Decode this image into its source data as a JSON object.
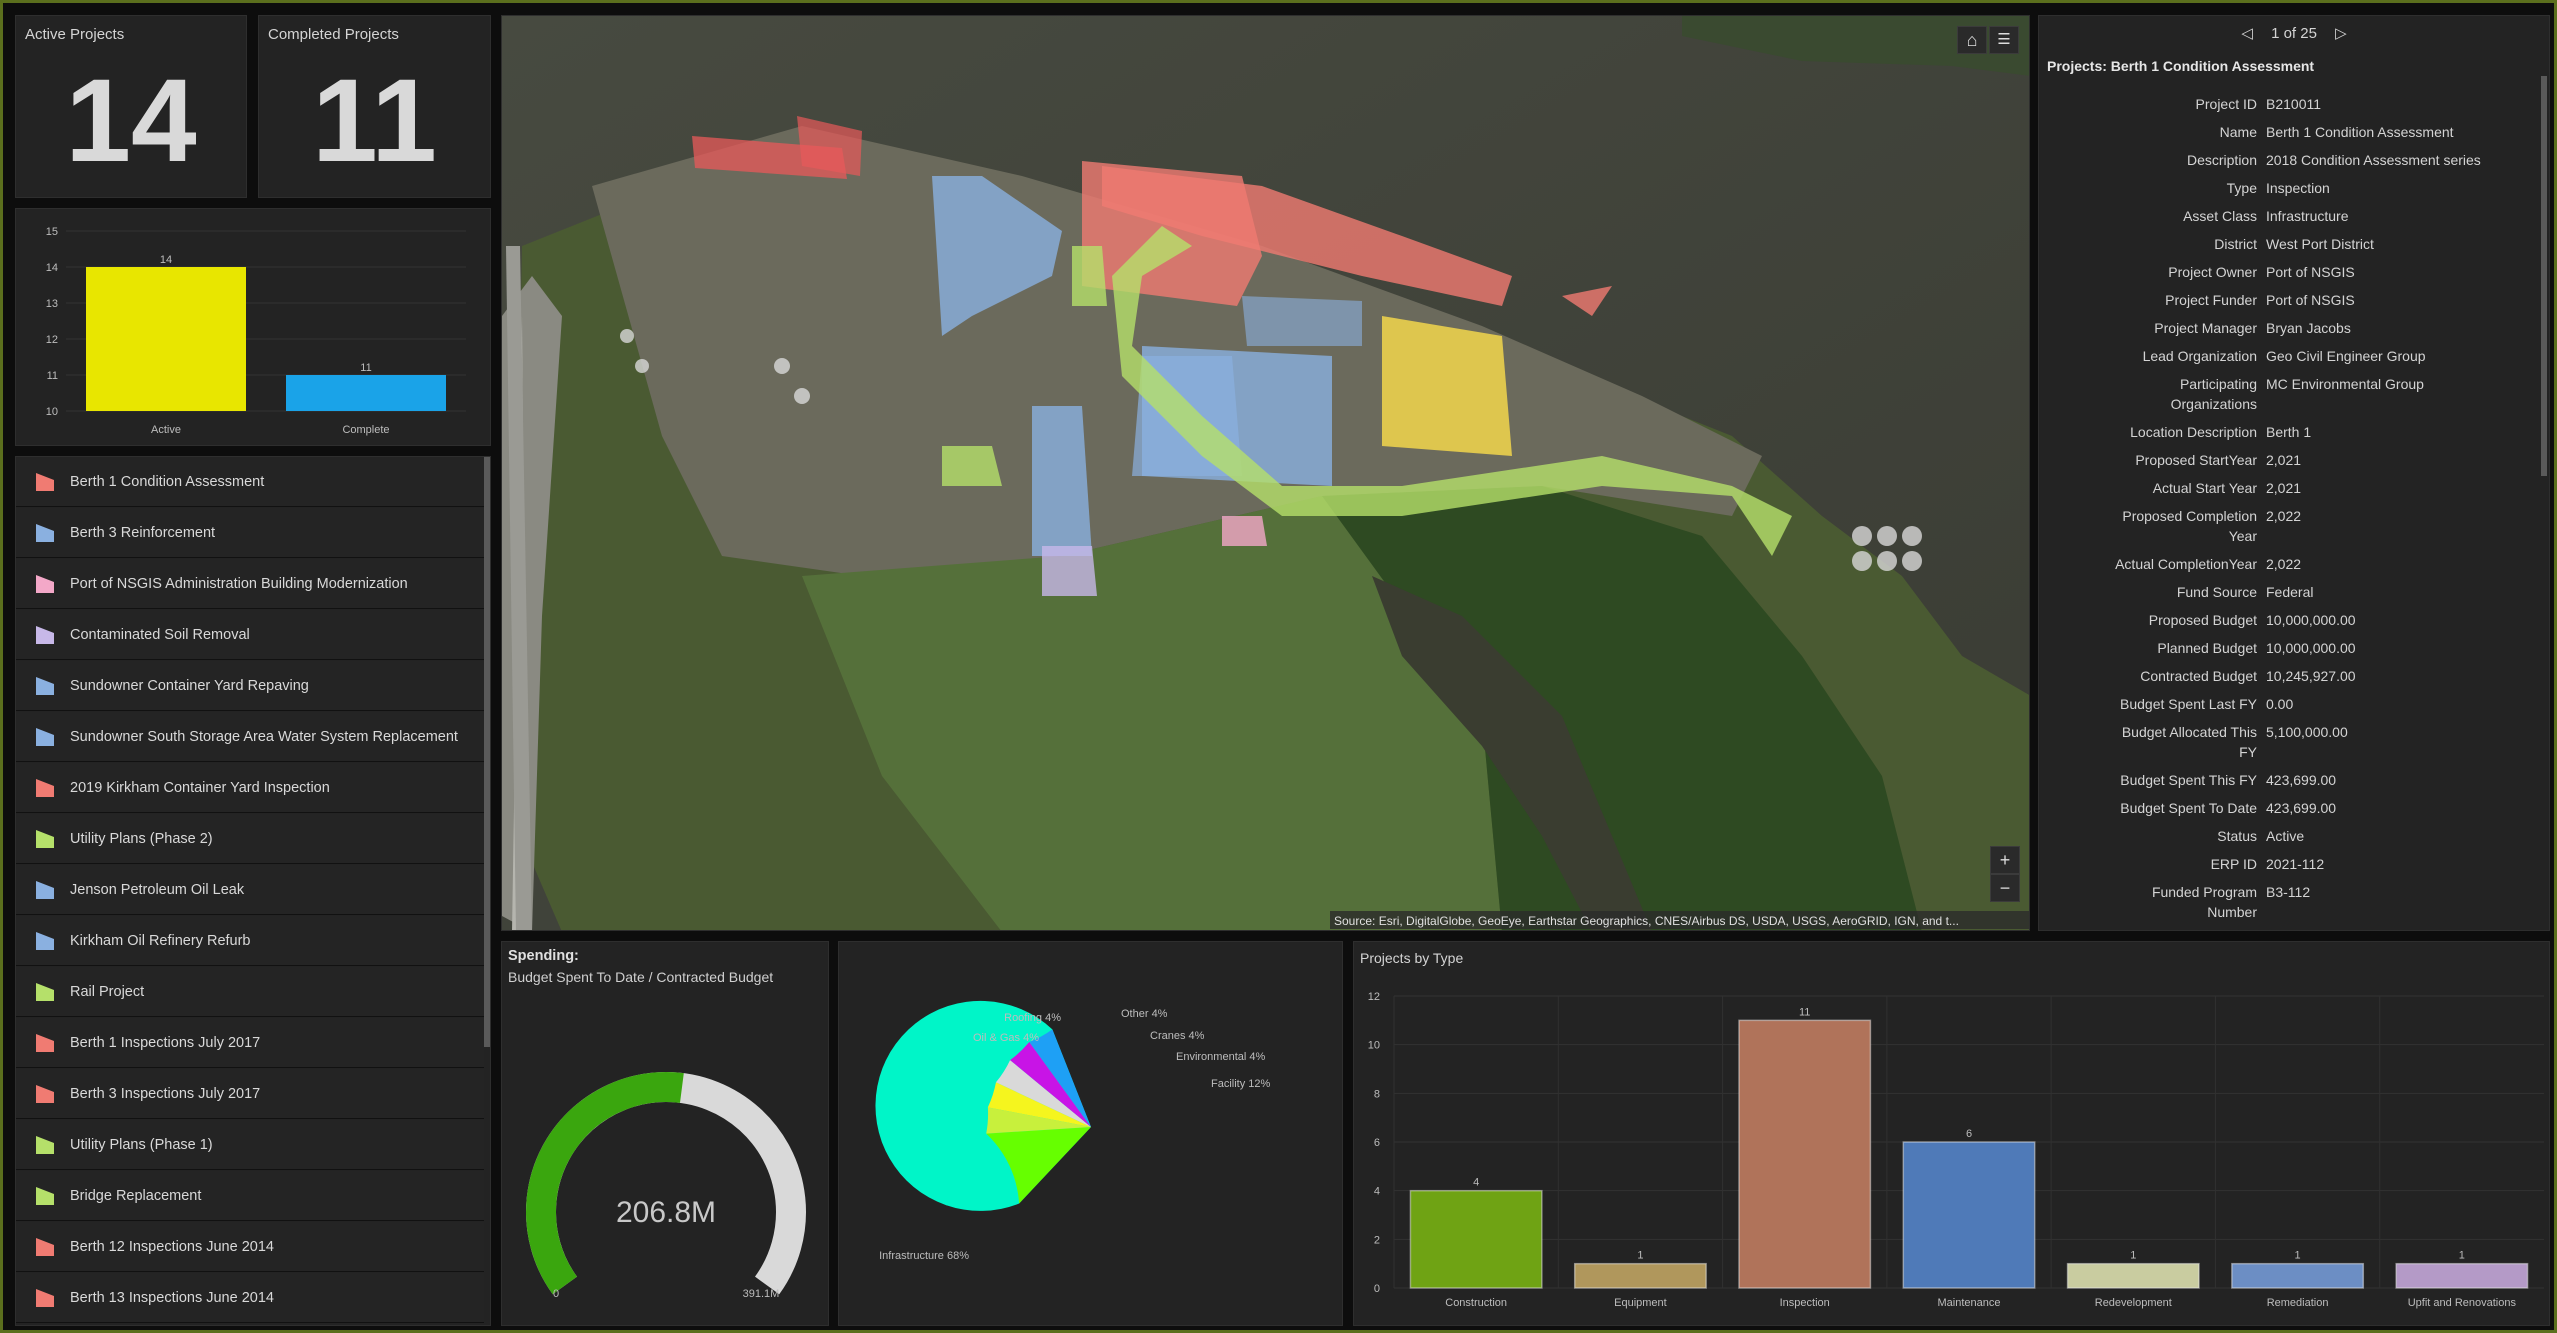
{
  "indicators": {
    "active": {
      "title": "Active Projects",
      "value": "14"
    },
    "completed": {
      "title": "Completed Projects",
      "value": "11"
    }
  },
  "status_chart": {
    "type": "bar",
    "categories": [
      "Active",
      "Complete"
    ],
    "values": [
      14,
      11
    ],
    "colors": [
      "#e8e600",
      "#1aa3e8"
    ],
    "ylim": [
      10,
      15
    ],
    "yticks": [
      "15",
      "14",
      "13",
      "12",
      "11",
      "10"
    ]
  },
  "project_list": [
    {
      "label": "Berth 1 Condition Assessment",
      "color": "#f07b72"
    },
    {
      "label": "Berth 3 Reinforcement",
      "color": "#8ab0e0"
    },
    {
      "label": "Port of NSGIS Administration Building Modernization",
      "color": "#f3a8c8"
    },
    {
      "label": "Contaminated Soil Removal",
      "color": "#c7b8e8"
    },
    {
      "label": "Sundowner Container Yard Repaving",
      "color": "#8ab0e0"
    },
    {
      "label": "Sundowner South Storage Area Water System Replacement",
      "color": "#8ab0e0"
    },
    {
      "label": "2019 Kirkham Container Yard Inspection",
      "color": "#f07b72"
    },
    {
      "label": "Utility Plans (Phase 2)",
      "color": "#b5e06a"
    },
    {
      "label": "Jenson Petroleum Oil Leak",
      "color": "#8ab0e0"
    },
    {
      "label": "Kirkham Oil Refinery Refurb",
      "color": "#8ab0e0"
    },
    {
      "label": "Rail Project",
      "color": "#b5e06a"
    },
    {
      "label": "Berth 1 Inspections July 2017",
      "color": "#f07b72"
    },
    {
      "label": "Berth 3 Inspections July 2017",
      "color": "#f07b72"
    },
    {
      "label": "Utility Plans (Phase 1)",
      "color": "#b5e06a"
    },
    {
      "label": "Bridge Replacement",
      "color": "#b5e06a"
    },
    {
      "label": "Berth 12 Inspections June 2014",
      "color": "#f07b72"
    },
    {
      "label": "Berth 13 Inspections June 2014",
      "color": "#f07b72"
    }
  ],
  "map": {
    "attribution": "Source: Esri, DigitalGlobe, GeoEye, Earthstar Geographics, CNES/Airbus DS, USDA, USGS, AeroGRID, IGN, and t...",
    "zoom_in": "+",
    "zoom_out": "−"
  },
  "details": {
    "pager": "1 of 25",
    "title": "Projects: Berth 1 Condition Assessment",
    "rows": [
      {
        "k": "Project ID",
        "v": "B210011"
      },
      {
        "k": "Name",
        "v": "Berth 1 Condition Assessment"
      },
      {
        "k": "Description",
        "v": "2018 Condition Assessment series"
      },
      {
        "k": "Type",
        "v": "Inspection"
      },
      {
        "k": "Asset Class",
        "v": "Infrastructure"
      },
      {
        "k": "District",
        "v": "West Port District"
      },
      {
        "k": "Project Owner",
        "v": "Port of NSGIS"
      },
      {
        "k": "Project Funder",
        "v": "Port of NSGIS"
      },
      {
        "k": "Project Manager",
        "v": "Bryan Jacobs"
      },
      {
        "k": "Lead Organization",
        "v": "Geo Civil Engineer Group"
      },
      {
        "k": "Participating\nOrganizations",
        "v": "MC Environmental Group"
      },
      {
        "k": "Location Description",
        "v": "Berth 1"
      },
      {
        "k": "Proposed StartYear",
        "v": "2,021"
      },
      {
        "k": "Actual Start Year",
        "v": "2,021"
      },
      {
        "k": "Proposed Completion\nYear",
        "v": "2,022"
      },
      {
        "k": "Actual CompletionYear",
        "v": "2,022"
      },
      {
        "k": "Fund Source",
        "v": "Federal"
      },
      {
        "k": "Proposed Budget",
        "v": "10,000,000.00"
      },
      {
        "k": "Planned Budget",
        "v": "10,000,000.00"
      },
      {
        "k": "Contracted Budget",
        "v": "10,245,927.00"
      },
      {
        "k": "Budget Spent Last FY",
        "v": "0.00"
      },
      {
        "k": "Budget Allocated This\nFY",
        "v": "5,100,000.00"
      },
      {
        "k": "Budget Spent This FY",
        "v": "423,699.00"
      },
      {
        "k": "Budget Spent To Date",
        "v": "423,699.00"
      },
      {
        "k": "Status",
        "v": "Active"
      },
      {
        "k": "ERP ID",
        "v": "2021-112"
      },
      {
        "k": "Funded Program\nNumber",
        "v": "B3-112"
      }
    ]
  },
  "gauge": {
    "title": "Spending:",
    "subtitle": "Budget Spent To Date / Contracted Budget",
    "value_label": "206.8M",
    "min_label": "0",
    "max_label": "391.1M",
    "fraction": 0.529,
    "fill_color": "#3aa60e",
    "track_color": "#d9d9d9"
  },
  "pie_chart": {
    "type": "pie",
    "slices": [
      {
        "label": "Infrastructure 68%",
        "value": 68,
        "color": "#00f5c8"
      },
      {
        "label": "Facility 12%",
        "value": 12,
        "color": "#66ff00"
      },
      {
        "label": "Environmental 4%",
        "value": 4,
        "color": "#c8f03c"
      },
      {
        "label": "Cranes 4%",
        "value": 4,
        "color": "#f5f51e"
      },
      {
        "label": "Other 4%",
        "value": 4,
        "color": "#d9d9d9"
      },
      {
        "label": "Roofing 4%",
        "value": 4,
        "color": "#c814e6"
      },
      {
        "label": "Oil & Gas 4%",
        "value": 4,
        "color": "#1ea0f5"
      }
    ]
  },
  "type_chart": {
    "type": "bar",
    "title": "Projects by Type",
    "categories": [
      "Construction",
      "Equipment",
      "Inspection",
      "Maintenance",
      "Redevelopment",
      "Remediation",
      "Upfit and Renovations"
    ],
    "values": [
      4,
      1,
      11,
      6,
      1,
      1,
      1
    ],
    "colors": [
      "#6fa314",
      "#b0975c",
      "#b0735a",
      "#4f7ab8",
      "#c9cca0",
      "#6c8ec4",
      "#b49ac7"
    ],
    "ylim": [
      0,
      12
    ],
    "yticks": [
      "12",
      "10",
      "8",
      "6",
      "4",
      "2",
      "0"
    ]
  }
}
